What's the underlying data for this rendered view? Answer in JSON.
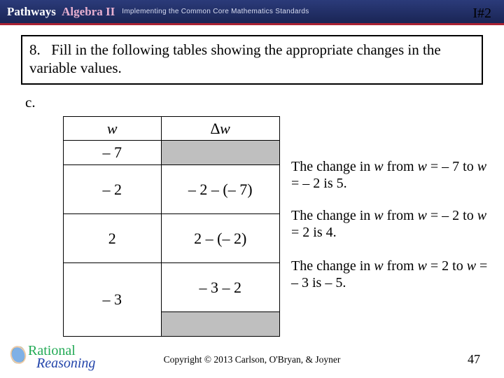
{
  "header": {
    "brand_a": "Pathways",
    "brand_b": "Algebra II",
    "tagline": "Implementing the Common Core Mathematics Standards",
    "page_id": "I#2"
  },
  "question": {
    "number": "8.",
    "text": "Fill in the following tables showing the appropriate changes in the variable values.",
    "sub": "c."
  },
  "table": {
    "head_w": "w",
    "head_dw": "∆w",
    "w": [
      "– 7",
      "– 2",
      "2",
      "– 3"
    ],
    "dw": [
      "– 2 – (– 7)",
      "2 – (– 2)",
      "– 3 – 2"
    ]
  },
  "explain": {
    "e1a": "The change in ",
    "e1v": "w",
    "e1b": " from ",
    "e1c": "w",
    "e1d": " = – 7 to ",
    "e1e": "w",
    "e1f": " = – 2 is 5.",
    "e2a": "The change in ",
    "e2v": "w",
    "e2b": " from ",
    "e2c": "w",
    "e2d": " = – 2 to ",
    "e2e": "w",
    "e2f": " = 2 is 4.",
    "e3a": "The change in ",
    "e3v": "w",
    "e3b": " from ",
    "e3c": "w",
    "e3d": " = 2 to ",
    "e3e": "w",
    "e3f": " = – 3 is – 5."
  },
  "footer": {
    "copyright": "Copyright © 2013 Carlson, O'Bryan, & Joyner",
    "page": "47",
    "logo1": "Rational",
    "logo2": "Reasoning"
  }
}
